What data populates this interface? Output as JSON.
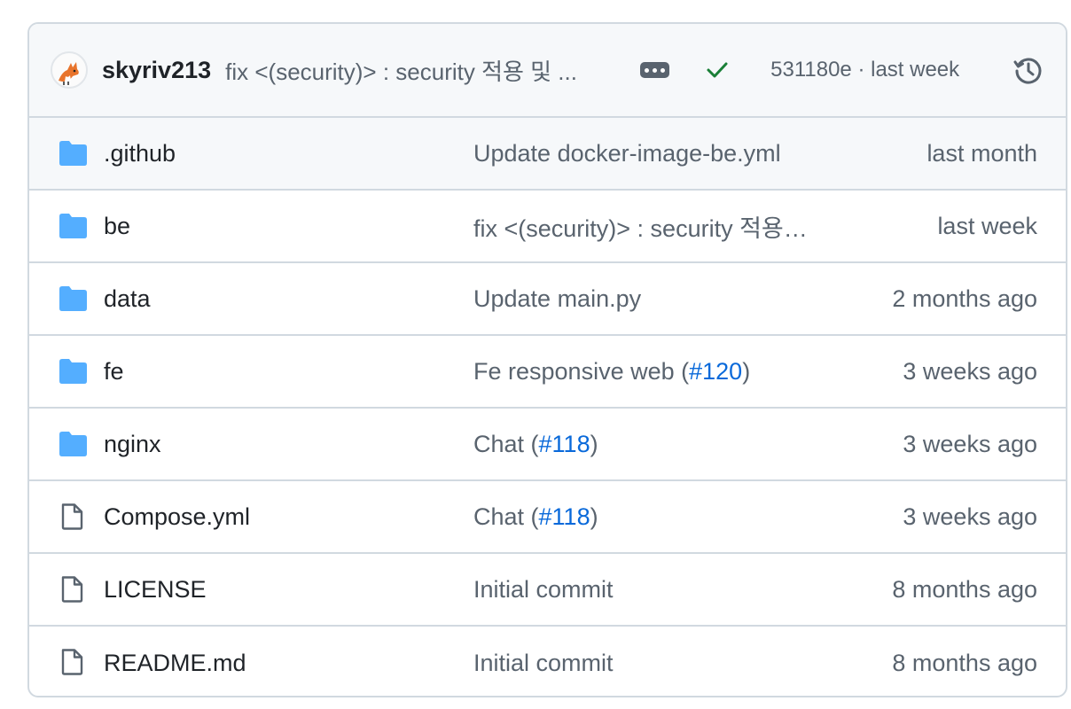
{
  "header": {
    "author": "skyriv213",
    "commit_message": "fix <(security)> : security 적용 및 ...",
    "sha_and_time": "531180e · last week",
    "avatar_icon": "fox-avatar-icon",
    "status_icon": "check-icon",
    "more_icon": "ellipsis-icon",
    "history_icon": "history-icon",
    "status_color": "#1a7f37"
  },
  "files": [
    {
      "type": "folder",
      "name": ".github",
      "msg_pre": "Update docker-image-be.yml",
      "pr": "",
      "msg_post": "",
      "date": "last month"
    },
    {
      "type": "folder",
      "name": "be",
      "msg_pre": "fix <(security)> : security 적용 및 ...",
      "pr": "",
      "msg_post": "",
      "date": "last week"
    },
    {
      "type": "folder",
      "name": "data",
      "msg_pre": "Update main.py",
      "pr": "",
      "msg_post": "",
      "date": "2 months ago"
    },
    {
      "type": "folder",
      "name": "fe",
      "msg_pre": "Fe responsive web (",
      "pr": "#120",
      "msg_post": ")",
      "date": "3 weeks ago"
    },
    {
      "type": "folder",
      "name": "nginx",
      "msg_pre": "Chat (",
      "pr": "#118",
      "msg_post": ")",
      "date": "3 weeks ago"
    },
    {
      "type": "file",
      "name": "Compose.yml",
      "msg_pre": "Chat (",
      "pr": "#118",
      "msg_post": ")",
      "date": "3 weeks ago"
    },
    {
      "type": "file",
      "name": "LICENSE",
      "msg_pre": "Initial commit",
      "pr": "",
      "msg_post": "",
      "date": "8 months ago"
    },
    {
      "type": "file",
      "name": "README.md",
      "msg_pre": "Initial commit",
      "pr": "",
      "msg_post": "",
      "date": "8 months ago"
    }
  ],
  "colors": {
    "folder": "#54aeff",
    "link": "#0969da",
    "muted": "#59636e"
  }
}
